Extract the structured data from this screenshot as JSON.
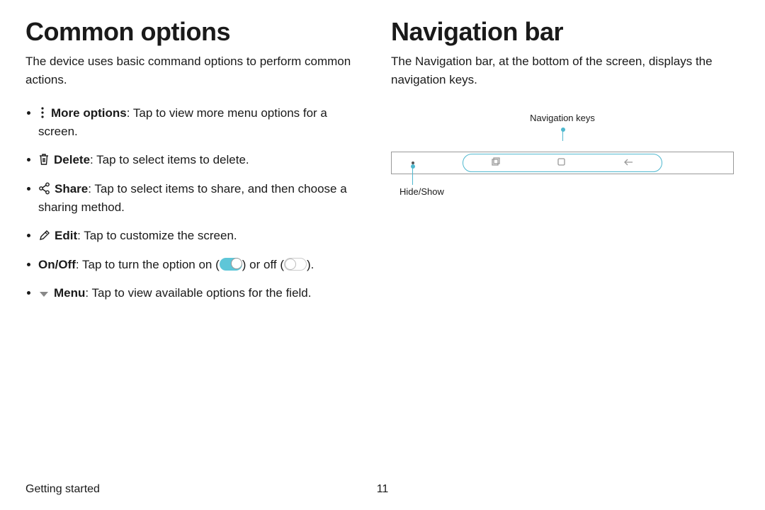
{
  "left": {
    "heading": "Common options",
    "intro": "The device uses basic command options to perform common actions.",
    "items": {
      "more": {
        "label": "More options",
        "text": ": Tap to view more menu options for a screen."
      },
      "delete": {
        "label": "Delete",
        "text": ": Tap to select items to delete."
      },
      "share": {
        "label": "Share",
        "text": ": Tap to select items to share, and then choose a sharing method."
      },
      "edit": {
        "label": "Edit",
        "text": ": Tap to customize the screen."
      },
      "onoff": {
        "label": "On/Off",
        "pre": ": Tap to turn the option on (",
        "mid": ") or off (",
        "post": ")."
      },
      "menu": {
        "label": "Menu",
        "text": ": Tap to view available options for the field."
      }
    }
  },
  "right": {
    "heading": "Navigation bar",
    "intro": "The Navigation bar, at the bottom of the screen, displays the navigation keys.",
    "labels": {
      "navkeys": "Navigation keys",
      "hideshow": "Hide/Show"
    }
  },
  "footer": {
    "section": "Getting started",
    "page": "11"
  }
}
